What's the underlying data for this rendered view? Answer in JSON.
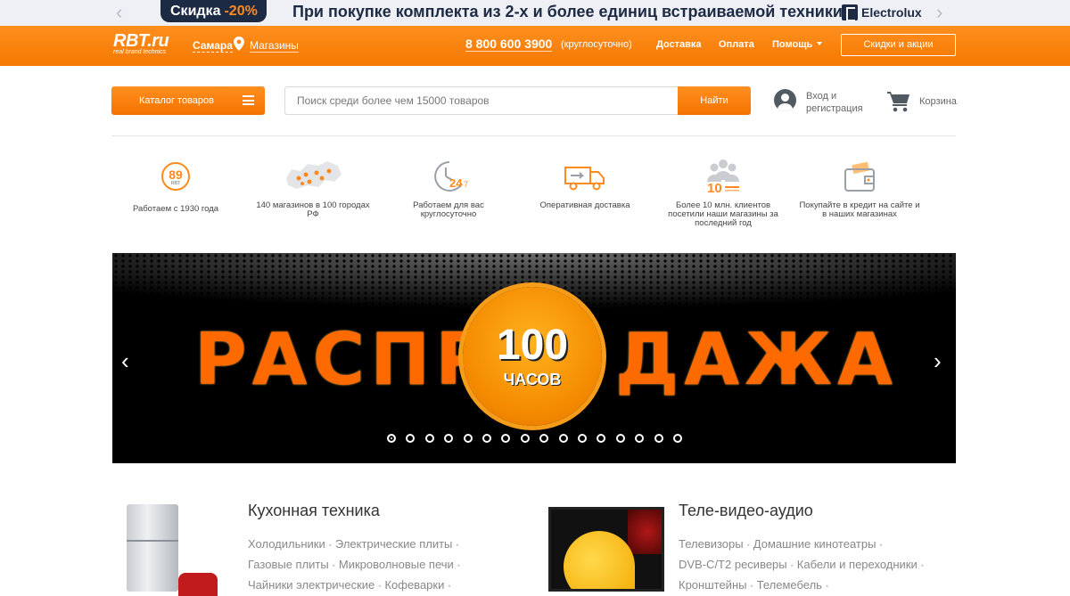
{
  "promo": {
    "badge_label": "Скидка",
    "badge_pct": "-20%",
    "text": "При покупке комплекта из 2-х и более единиц встраиваемой техники",
    "brand": "Electrolux"
  },
  "header": {
    "logo": "RBT.ru",
    "logo_sub": "real brand technics",
    "city": "Самара",
    "stores": "Магазины",
    "phone": "8 800 600 3900",
    "phone_note": "(круглосуточно)",
    "nav": {
      "delivery": "Доставка",
      "payment": "Оплата",
      "help": "Помощь"
    },
    "promo_button": "Скидки и акции"
  },
  "search": {
    "catalog_label": "Каталог товаров",
    "placeholder": "Поиск среди более чем 15000 товаров",
    "button": "Найти",
    "login": "Вход и регистрация",
    "cart": "Корзина"
  },
  "features": [
    {
      "text": "Работаем с 1930 года",
      "icon": "89-years-badge-icon",
      "badge": "89",
      "badge_sub": "RBT"
    },
    {
      "text": "140 магазинов в 100 городах РФ",
      "icon": "russia-map-icon"
    },
    {
      "text": "Работаем для вас круглосуточно",
      "icon": "clock-24-7-icon",
      "clock_label": "24",
      "clock_sub": "7"
    },
    {
      "text": "Оперативная доставка",
      "icon": "delivery-truck-icon"
    },
    {
      "text": "Более 10 млн. клиентов посетили наши магазины за последний год",
      "icon": "customers-crowd-icon",
      "count_label": "10"
    },
    {
      "text": "Покупайте в кредит на сайте и в наших магазинах",
      "icon": "wallet-icon"
    }
  ],
  "banner": {
    "word_left": "РАСПР",
    "word_right": "ДАЖА",
    "number": "100",
    "unit": "ЧАСОВ",
    "slide_count": 16,
    "active_slide": 0
  },
  "categories": [
    {
      "title": "Кухонная техника",
      "image": "fridge-kettle-image",
      "links": [
        "Холодильники",
        "Электрические плиты",
        "Газовые плиты",
        "Микроволновые печи",
        "Чайники электрические",
        "Кофеварки"
      ]
    },
    {
      "title": "Теле-видео-аудио",
      "image": "tv-image",
      "links": [
        "Телевизоры",
        "Домашние кинотеатры",
        "DVB-C/T2 ресиверы",
        "Кабели и переходники",
        "Кронштейны",
        "Телемебель"
      ]
    }
  ],
  "colors": {
    "brand_orange": "#f47800",
    "promo_navy": "#1d2a44"
  }
}
